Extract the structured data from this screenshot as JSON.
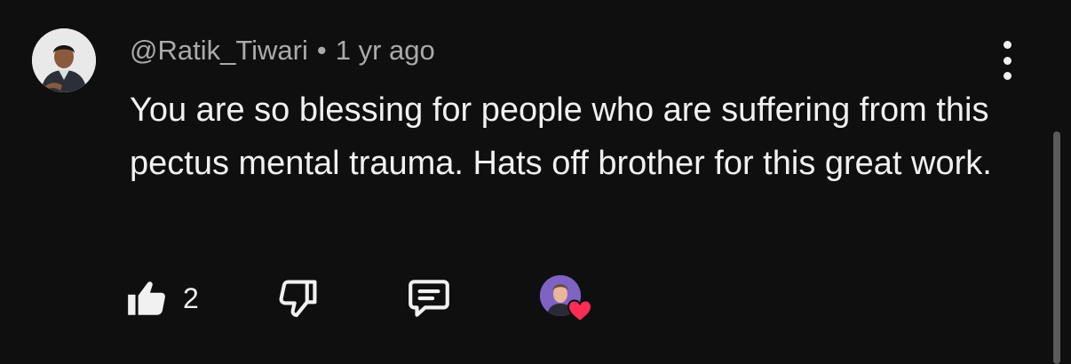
{
  "comment": {
    "author": "@Ratik_Tiwari",
    "separator": "•",
    "timestamp": "1 yr ago",
    "text": "You are so blessing for people who are suffering from this pectus mental trauma. Hats off brother for this great work."
  },
  "actions": {
    "like_count": "2"
  },
  "icons": {
    "menu": "more-vert-icon",
    "like": "thumb-up-icon",
    "dislike": "thumb-down-icon",
    "reply": "reply-comment-icon",
    "creator_heart": "heart-icon"
  },
  "colors": {
    "background": "#0f0f0f",
    "primary_text": "#f1f1f1",
    "secondary_text": "#aaaaaa",
    "heart": "#ff2d55",
    "creator_avatar_bg": "#7e62c4"
  }
}
